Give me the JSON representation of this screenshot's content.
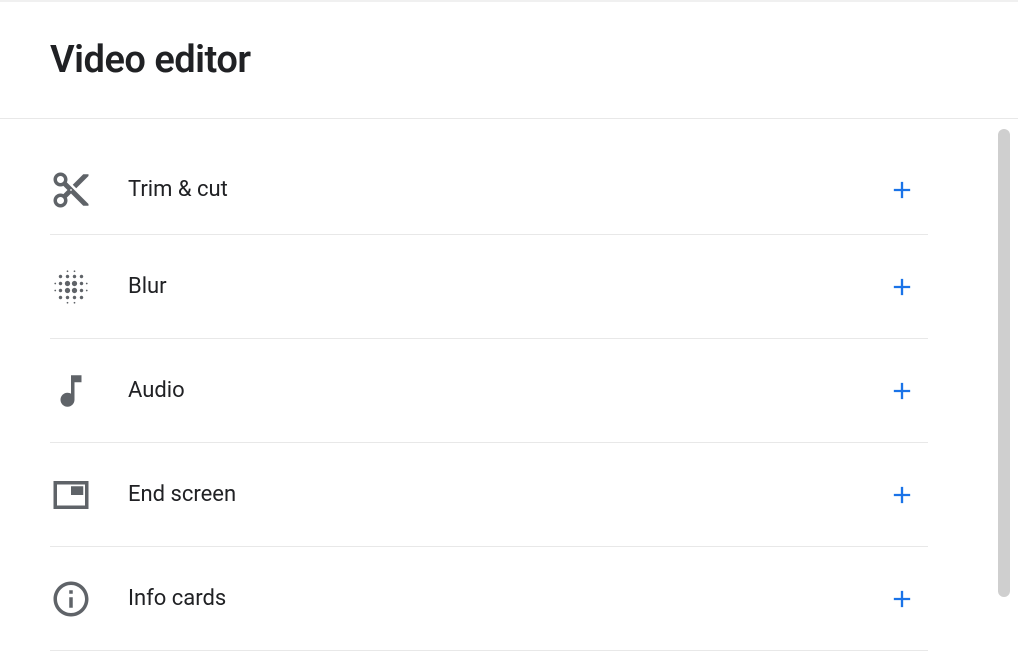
{
  "header": {
    "title": "Video editor"
  },
  "editor": {
    "rows": [
      {
        "icon": "scissors",
        "label": "Trim & cut"
      },
      {
        "icon": "blur",
        "label": "Blur"
      },
      {
        "icon": "audio",
        "label": "Audio"
      },
      {
        "icon": "endscreen",
        "label": "End screen"
      },
      {
        "icon": "info",
        "label": "Info cards"
      }
    ]
  },
  "colors": {
    "accent": "#1a73e8",
    "icon": "#5f6368",
    "text": "#202124",
    "divider": "#e8e8e8"
  }
}
